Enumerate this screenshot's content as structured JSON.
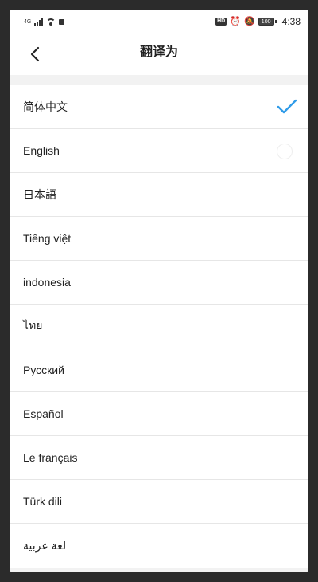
{
  "status_bar": {
    "network": "4G",
    "hd_badge": "HD",
    "battery": "100",
    "time": "4:38"
  },
  "header": {
    "title": "翻译为",
    "back_icon": "chevron-left-icon"
  },
  "languages": [
    {
      "label": "简体中文",
      "selected": true
    },
    {
      "label": "English",
      "selected": false
    },
    {
      "label": "日本語",
      "selected": false
    },
    {
      "label": "Tiếng việt",
      "selected": false
    },
    {
      "label": "indonesia",
      "selected": false
    },
    {
      "label": "ไทย",
      "selected": false
    },
    {
      "label": "Русский",
      "selected": false
    },
    {
      "label": "Español",
      "selected": false
    },
    {
      "label": "Le français",
      "selected": false
    },
    {
      "label": "Türk dili",
      "selected": false
    },
    {
      "label": "لغة عربية",
      "selected": false
    }
  ],
  "colors": {
    "accent": "#2f9be8",
    "background": "#f2f2f2",
    "row": "#ffffff",
    "divider": "#e6e6e6"
  }
}
